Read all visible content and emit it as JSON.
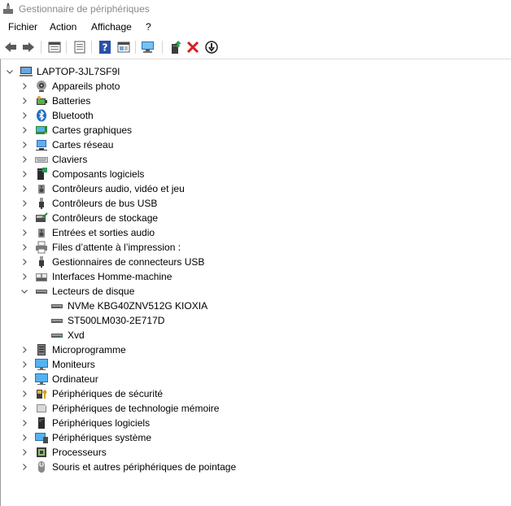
{
  "window": {
    "title": "Gestionnaire de périphériques"
  },
  "menu": [
    {
      "label": "Fichier"
    },
    {
      "label": "Action"
    },
    {
      "label": "Affichage"
    },
    {
      "label": "?"
    }
  ],
  "toolbar": [
    {
      "name": "back-arrow-icon",
      "sep_before": false
    },
    {
      "name": "forward-arrow-icon",
      "sep_before": false
    },
    {
      "name": "properties-sheet-icon",
      "sep_before": true
    },
    {
      "name": "view-list-icon",
      "sep_before": true
    },
    {
      "name": "help-icon",
      "sep_before": true
    },
    {
      "name": "panel-view-icon",
      "sep_before": false
    },
    {
      "name": "scan-hardware-icon",
      "sep_before": true
    },
    {
      "name": "update-driver-icon",
      "sep_before": true
    },
    {
      "name": "uninstall-device-icon",
      "sep_before": false
    },
    {
      "name": "disable-device-icon",
      "sep_before": false
    }
  ],
  "tree": {
    "root": {
      "label": "LAPTOP-3JL7SF9I",
      "icon": "computer-icon",
      "expanded": true
    },
    "items": [
      {
        "label": "Appareils photo",
        "icon": "camera-icon",
        "expanded": false,
        "children": []
      },
      {
        "label": "Batteries",
        "icon": "battery-icon",
        "expanded": false,
        "children": []
      },
      {
        "label": "Bluetooth",
        "icon": "bluetooth-icon",
        "expanded": false,
        "children": []
      },
      {
        "label": "Cartes graphiques",
        "icon": "display-adapter-icon",
        "expanded": false,
        "children": []
      },
      {
        "label": "Cartes réseau",
        "icon": "network-adapter-icon",
        "expanded": false,
        "children": []
      },
      {
        "label": "Claviers",
        "icon": "keyboard-icon",
        "expanded": false,
        "children": []
      },
      {
        "label": "Composants logiciels",
        "icon": "software-component-icon",
        "expanded": false,
        "children": []
      },
      {
        "label": "Contrôleurs audio, vidéo et jeu",
        "icon": "speaker-icon",
        "expanded": false,
        "children": []
      },
      {
        "label": "Contrôleurs de bus USB",
        "icon": "usb-icon",
        "expanded": false,
        "children": []
      },
      {
        "label": "Contrôleurs de stockage",
        "icon": "storage-controller-icon",
        "expanded": false,
        "children": []
      },
      {
        "label": "Entrées et sorties audio",
        "icon": "speaker-icon",
        "expanded": false,
        "children": []
      },
      {
        "label": "Files d’attente à l’impression :",
        "icon": "printer-icon",
        "expanded": false,
        "children": []
      },
      {
        "label": "Gestionnaires de connecteurs USB",
        "icon": "usb-icon",
        "expanded": false,
        "children": []
      },
      {
        "label": "Interfaces Homme-machine",
        "icon": "hid-icon",
        "expanded": false,
        "children": []
      },
      {
        "label": "Lecteurs de disque",
        "icon": "disk-drive-icon",
        "expanded": true,
        "children": [
          {
            "label": "NVMe KBG40ZNV512G KIOXIA",
            "icon": "disk-drive-icon"
          },
          {
            "label": "ST500LM030-2E717D",
            "icon": "disk-drive-icon"
          },
          {
            "label": "Xvd",
            "icon": "disk-drive-icon"
          }
        ]
      },
      {
        "label": "Microprogramme",
        "icon": "firmware-icon",
        "expanded": false,
        "children": []
      },
      {
        "label": "Moniteurs",
        "icon": "monitor-icon",
        "expanded": false,
        "children": []
      },
      {
        "label": "Ordinateur",
        "icon": "monitor-icon",
        "expanded": false,
        "children": []
      },
      {
        "label": "Périphériques de sécurité",
        "icon": "security-key-icon",
        "expanded": false,
        "children": []
      },
      {
        "label": "Périphériques de technologie mémoire",
        "icon": "memory-card-icon",
        "expanded": false,
        "children": []
      },
      {
        "label": "Périphériques logiciels",
        "icon": "software-device-icon",
        "expanded": false,
        "children": []
      },
      {
        "label": "Périphériques système",
        "icon": "system-device-icon",
        "expanded": false,
        "children": []
      },
      {
        "label": "Processeurs",
        "icon": "processor-icon",
        "expanded": false,
        "children": []
      },
      {
        "label": "Souris et autres périphériques de pointage",
        "icon": "mouse-icon",
        "expanded": false,
        "children": []
      }
    ]
  }
}
